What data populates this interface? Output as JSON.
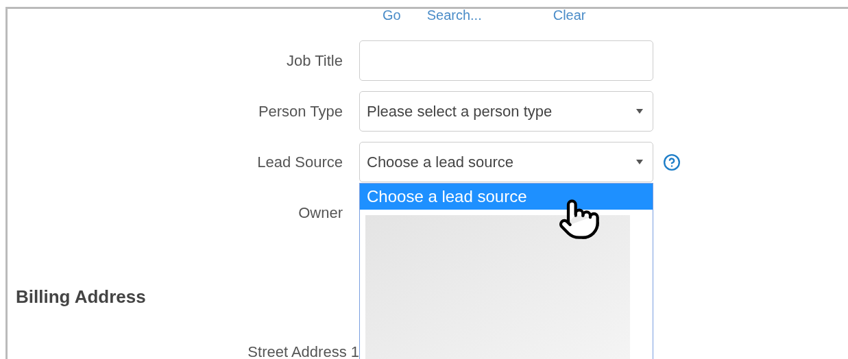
{
  "search_links": [
    {
      "label": "Go"
    },
    {
      "label": "Search..."
    },
    {
      "label": "Clear"
    }
  ],
  "fields": [
    {
      "label": "Job Title",
      "kind": "text"
    },
    {
      "label": "Person Type",
      "kind": "select",
      "value": "Please select a person type"
    },
    {
      "label": "Lead Source",
      "kind": "select",
      "value": "Choose a lead source",
      "help": true,
      "options": [
        {
          "label": "Choose a lead source",
          "selected": true
        }
      ]
    },
    {
      "label": "Owner",
      "kind": "covered"
    }
  ],
  "section": {
    "title": "Billing Address",
    "fields": [
      {
        "label": "Street Address 1"
      }
    ]
  }
}
